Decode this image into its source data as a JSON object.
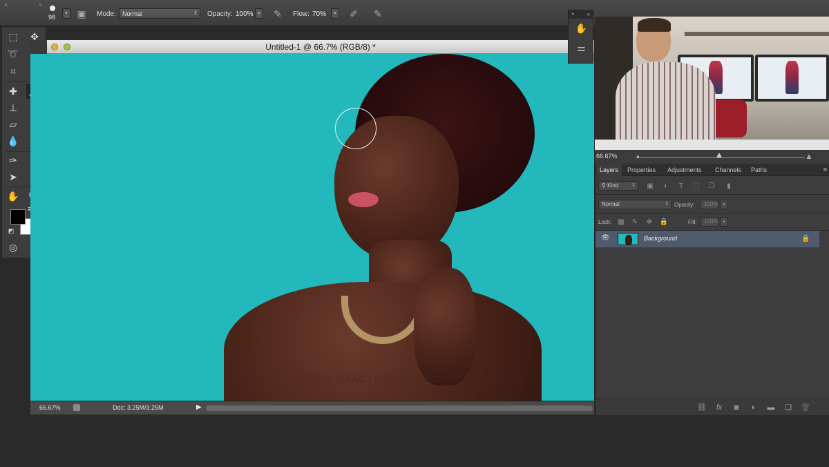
{
  "options_bar": {
    "brush_size": "98",
    "mode_label": "Mode:",
    "mode_value": "Normal",
    "opacity_label": "Opacity:",
    "opacity_value": "100%",
    "flow_label": "Flow:",
    "flow_value": "70%"
  },
  "document": {
    "title": "Untitled-1 @ 66.7% (RGB/8) *",
    "watermark": "OFERD ISAAC | REPUBLIC311 PHOTOGRAPHY",
    "zoom": "66.67%",
    "doc_size": "Doc: 3.25M/3.25M",
    "canvas_color": "#22b8bc"
  },
  "navigator": {
    "zoom": "66.67%"
  },
  "layers_panel": {
    "tabs": [
      "Layers",
      "Properties",
      "Adjustments",
      "Channels",
      "Paths"
    ],
    "filter_kind": "Kind",
    "blend_mode": "Normal",
    "opacity_label": "Opacity:",
    "opacity_value": "100%",
    "lock_label": "Lock:",
    "fill_label": "Fill:",
    "fill_value": "100%",
    "layers": [
      {
        "name": "Background",
        "visible": true,
        "locked": true
      }
    ]
  },
  "tools": {
    "foreground_color": "#000000",
    "background_color": "#ffffff",
    "active_tool": "brush-tool"
  }
}
